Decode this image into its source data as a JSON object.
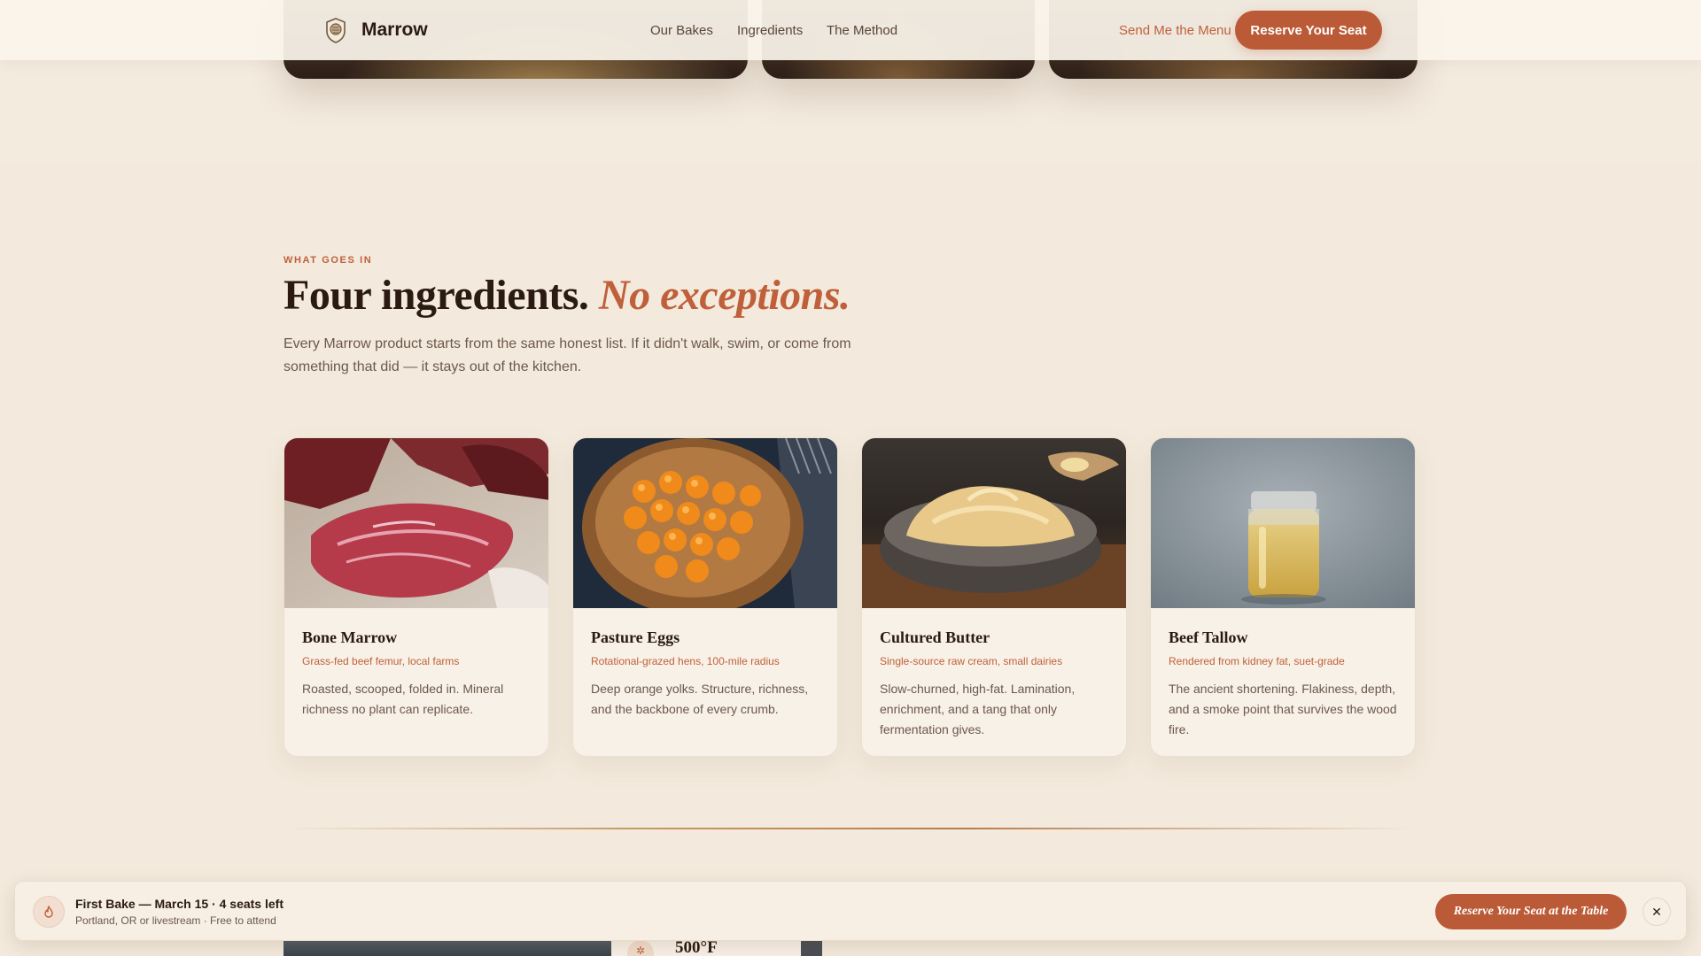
{
  "header": {
    "brand": "Marrow",
    "nav": [
      "Our Bakes",
      "Ingredients",
      "The Method"
    ],
    "send_menu": "Send Me the Menu",
    "reserve": "Reserve Your Seat"
  },
  "ingredients": {
    "eyebrow": "WHAT GOES IN",
    "headline_main": "Four ingredients.",
    "headline_accent": "No exceptions.",
    "lede": "Every Marrow product starts from the same honest list. If it didn't walk, swim, or come from something that did — it stays out of the kitchen.",
    "cards": [
      {
        "title": "Bone Marrow",
        "subtitle": "Grass-fed beef femur, local farms",
        "description": "Roasted, scooped, folded in. Mineral richness no plant can replicate."
      },
      {
        "title": "Pasture Eggs",
        "subtitle": "Rotational-grazed hens, 100-mile radius",
        "description": "Deep orange yolks. Structure, richness, and the backbone of every crumb."
      },
      {
        "title": "Cultured Butter",
        "subtitle": "Single-source raw cream, small dairies",
        "description": "Slow-churned, high-fat. Lamination, enrichment, and a tang that only fermentation gives."
      },
      {
        "title": "Beef Tallow",
        "subtitle": "Rendered from kidney fat, suet-grade",
        "description": "The ancient shortening. Flakiness, depth, and a smoke point that survives the wood fire."
      }
    ]
  },
  "next_section": {
    "temperature": "500°F"
  },
  "banner": {
    "title": "First Bake — March 15 · 4 seats left",
    "subtitle": "Portland, OR or livestream · Free to attend",
    "cta": "Reserve Your Seat at the Table",
    "close_glyph": "✕"
  },
  "colors": {
    "accent": "#bb5a36",
    "background": "#f3eadd",
    "ink": "#2a1a12"
  }
}
